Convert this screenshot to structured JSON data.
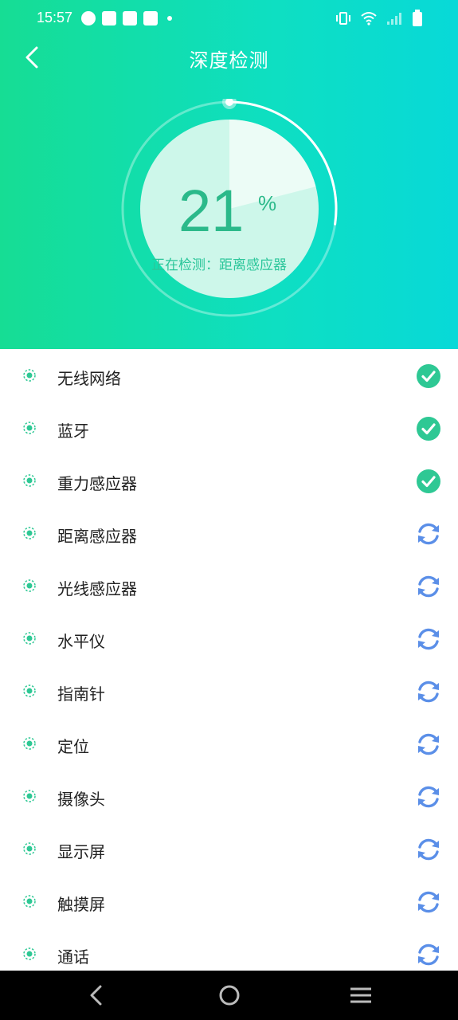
{
  "status_bar": {
    "time": "15:57"
  },
  "header": {
    "title": "深度检测",
    "progress_value": "21",
    "progress_unit": "%",
    "progress_fraction": 0.21,
    "detecting_text": "正在检测：距离感应器"
  },
  "items": [
    {
      "label": "无线网络",
      "status": "done"
    },
    {
      "label": "蓝牙",
      "status": "done"
    },
    {
      "label": "重力感应器",
      "status": "done"
    },
    {
      "label": "距离感应器",
      "status": "checking"
    },
    {
      "label": "光线感应器",
      "status": "checking"
    },
    {
      "label": "水平仪",
      "status": "checking"
    },
    {
      "label": "指南针",
      "status": "checking"
    },
    {
      "label": "定位",
      "status": "checking"
    },
    {
      "label": "摄像头",
      "status": "checking"
    },
    {
      "label": "显示屏",
      "status": "checking"
    },
    {
      "label": "触摸屏",
      "status": "checking"
    },
    {
      "label": "通话",
      "status": "checking"
    }
  ],
  "colors": {
    "accent_green": "#2ec894",
    "refresh_blue": "#5b8fe8",
    "header_start": "#16dd94",
    "header_end": "#08d9d8"
  }
}
